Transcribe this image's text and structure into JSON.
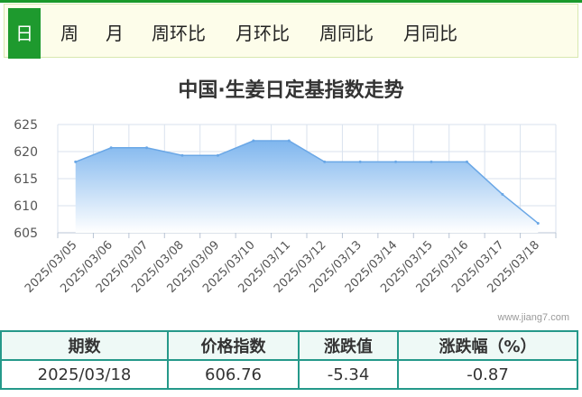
{
  "tabs": [
    {
      "label": "日",
      "active": true
    },
    {
      "label": "周",
      "active": false
    },
    {
      "label": "月",
      "active": false
    },
    {
      "label": "周环比",
      "active": false
    },
    {
      "label": "月环比",
      "active": false
    },
    {
      "label": "周同比",
      "active": false
    },
    {
      "label": "月同比",
      "active": false
    }
  ],
  "colors": {
    "tab_active": "#1e9a2e",
    "area_top": "#7fb6ee",
    "area_bottom": "#ffffff",
    "table_border": "#25998a"
  },
  "source": "www.jiang7.com",
  "chart_data": {
    "type": "area",
    "title": "中国·生姜日定基指数走势",
    "xlabel": "",
    "ylabel": "",
    "ylim": [
      605,
      625
    ],
    "yticks": [
      605,
      610,
      615,
      620,
      625
    ],
    "grid": true,
    "categories": [
      "2025/03/05",
      "2025/03/06",
      "2025/03/07",
      "2025/03/08",
      "2025/03/09",
      "2025/03/10",
      "2025/03/11",
      "2025/03/12",
      "2025/03/13",
      "2025/03/14",
      "2025/03/15",
      "2025/03/16",
      "2025/03/17",
      "2025/03/18"
    ],
    "series": [
      {
        "values": [
          618.1,
          620.7,
          620.7,
          619.3,
          619.3,
          622.0,
          622.0,
          618.1,
          618.1,
          618.1,
          618.1,
          618.1,
          612.1,
          606.76
        ]
      }
    ]
  },
  "table": {
    "headers": [
      "期数",
      "价格指数",
      "涨跌值",
      "涨跌幅（%）"
    ],
    "row": [
      "2025/03/18",
      "606.76",
      "-5.34",
      "-0.87"
    ]
  }
}
